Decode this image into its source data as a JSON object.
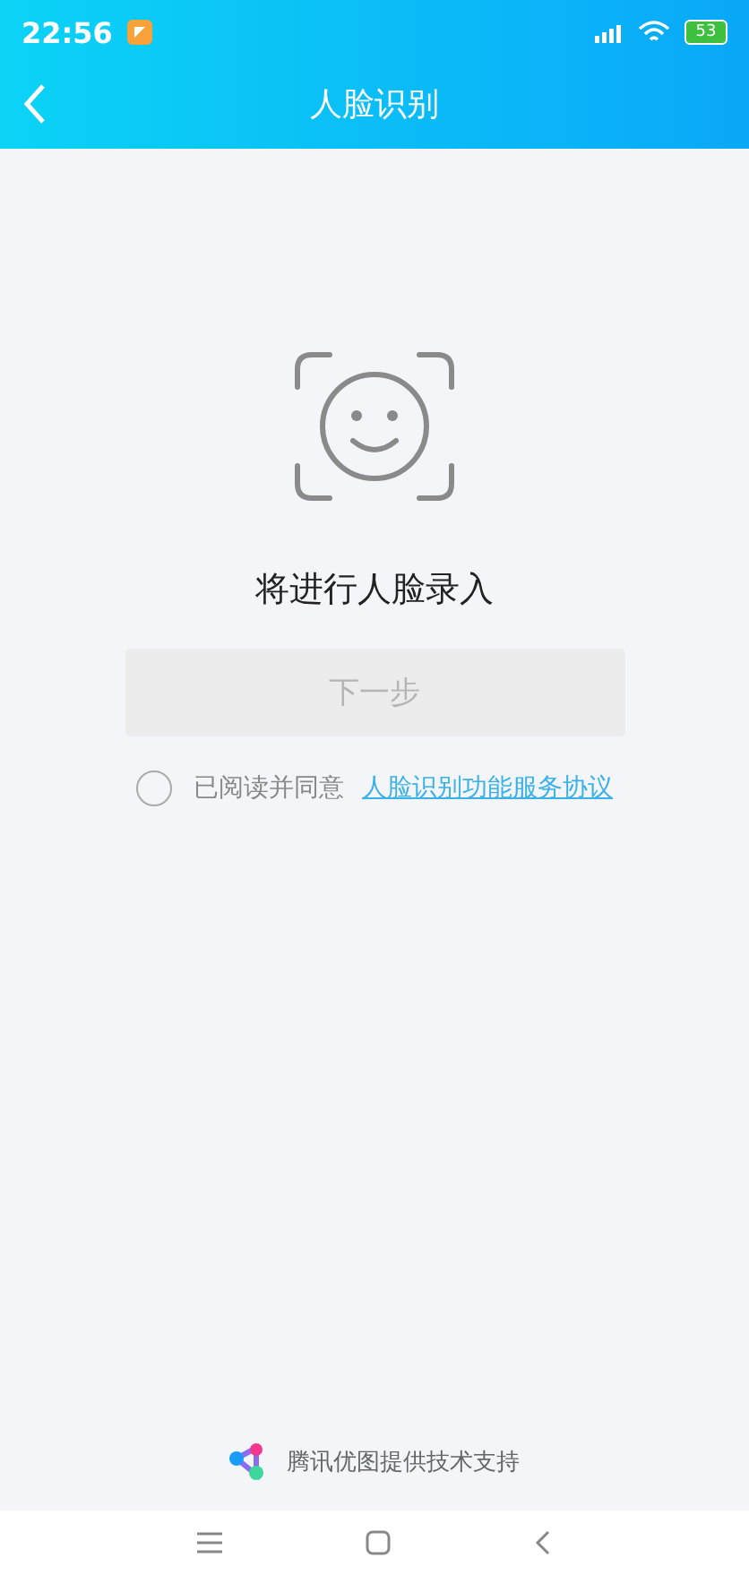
{
  "status_bar": {
    "time": "22:56",
    "battery": "53"
  },
  "header": {
    "title": "人脸识别"
  },
  "prompt": "将进行人脸录入",
  "next_button": {
    "label": "下一步",
    "disabled": true
  },
  "agreement": {
    "checked": false,
    "text": "已阅读并同意",
    "link": "人脸识别功能服务协议"
  },
  "footer": {
    "text": "腾讯优图提供技术支持"
  }
}
